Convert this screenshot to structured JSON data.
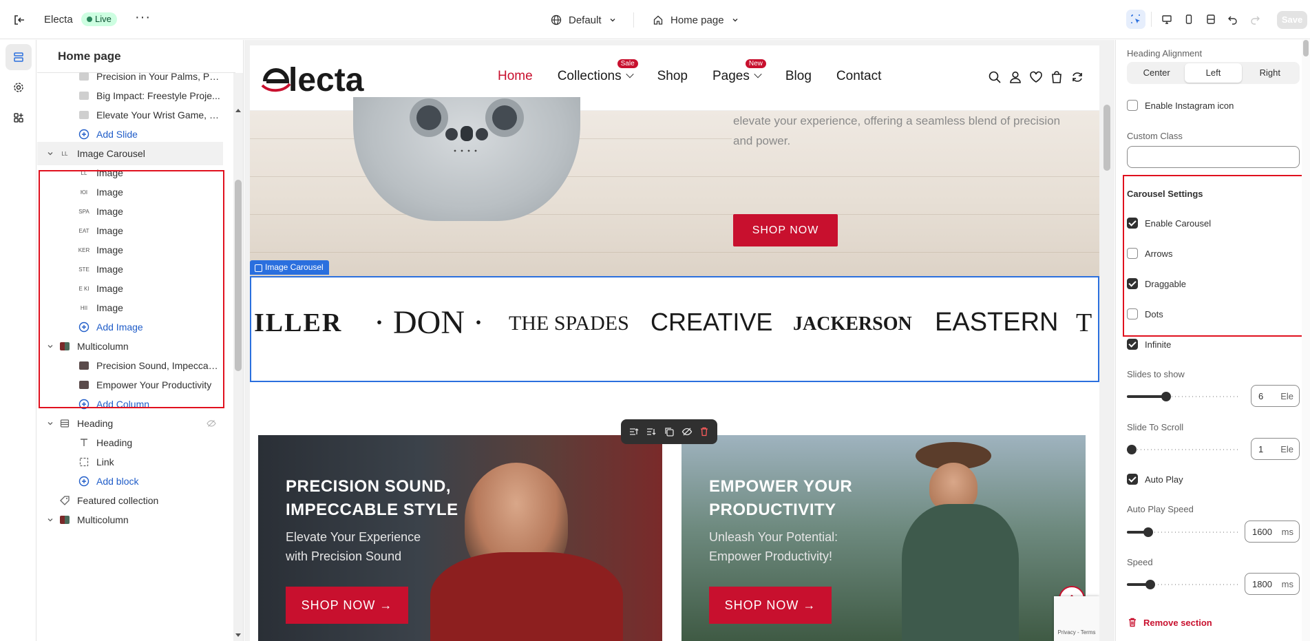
{
  "topbar": {
    "app_name": "Electa",
    "status": "Live",
    "theme": "Default",
    "page": "Home page",
    "save_label": "Save"
  },
  "tree": {
    "title": "Home page",
    "rows": [
      {
        "label": "Precision in Your Palms, Po...",
        "level": 2,
        "icon": "slide-thumb"
      },
      {
        "label": "Big Impact: Freestyle Proje...",
        "level": 2,
        "icon": "slide-thumb"
      },
      {
        "label": "Elevate Your Wrist Game, El...",
        "level": 2,
        "icon": "slide-thumb"
      },
      {
        "label": "Add Slide",
        "level": 2,
        "icon": "plus-circle-icon",
        "add": true
      },
      {
        "label": "Image Carousel",
        "level": 1,
        "icon": "carousel-thumb",
        "expanded": true,
        "selected": true
      },
      {
        "label": "Image",
        "level": 2,
        "icon": "brand-thumb",
        "thumb": "LL"
      },
      {
        "label": "Image",
        "level": 2,
        "icon": "brand-thumb",
        "thumb": "ЮI"
      },
      {
        "label": "Image",
        "level": 2,
        "icon": "brand-thumb",
        "thumb": "SPA"
      },
      {
        "label": "Image",
        "level": 2,
        "icon": "brand-thumb",
        "thumb": "EAT"
      },
      {
        "label": "Image",
        "level": 2,
        "icon": "brand-thumb",
        "thumb": "KER"
      },
      {
        "label": "Image",
        "level": 2,
        "icon": "brand-thumb",
        "thumb": "STE"
      },
      {
        "label": "Image",
        "level": 2,
        "icon": "brand-thumb",
        "thumb": "E KI"
      },
      {
        "label": "Image",
        "level": 2,
        "icon": "brand-thumb",
        "thumb": "HII"
      },
      {
        "label": "Add Image",
        "level": 2,
        "icon": "plus-circle-icon",
        "add": true
      },
      {
        "label": "Multicolumn",
        "level": 1,
        "icon": "multicolumn-thumb",
        "expanded": true
      },
      {
        "label": "Precision Sound, Impeccab...",
        "level": 2,
        "icon": "column-thumb"
      },
      {
        "label": "Empower Your Productivity",
        "level": 2,
        "icon": "column-thumb"
      },
      {
        "label": "Add Column",
        "level": 2,
        "icon": "plus-circle-icon",
        "add": true
      },
      {
        "label": "Heading",
        "level": 1,
        "icon": "heading-section-icon",
        "expanded": true,
        "hidden": true
      },
      {
        "label": "Heading",
        "level": 2,
        "icon": "text-icon"
      },
      {
        "label": "Link",
        "level": 2,
        "icon": "link-icon"
      },
      {
        "label": "Add block",
        "level": 2,
        "icon": "plus-circle-icon",
        "add": true
      },
      {
        "label": "Featured collection",
        "level": 1,
        "icon": "tag-icon"
      },
      {
        "label": "Multicolumn",
        "level": 1,
        "icon": "multicolumn-thumb",
        "expanded": true
      }
    ]
  },
  "store": {
    "logo": "electa",
    "nav": [
      {
        "label": "Home",
        "active": true
      },
      {
        "label": "Collections",
        "badge": "Sale",
        "dropdown": true
      },
      {
        "label": "Shop"
      },
      {
        "label": "Pages",
        "badge": "New",
        "dropdown": true
      },
      {
        "label": "Blog"
      },
      {
        "label": "Contact"
      }
    ],
    "hero": {
      "text": "elevate your experience, offering a seamless blend of precision and power.",
      "button": "SHOP NOW"
    },
    "section_tag": "Image Carousel",
    "brands": [
      "ILLER",
      "· DON ·",
      "THE SPADES",
      "CREATIVE",
      "JACKERSON",
      "EASTERN",
      "T"
    ],
    "banners": [
      {
        "title_line1": "PRECISION SOUND,",
        "title_line2": "IMPECCABLE STYLE",
        "sub_line1": "Elevate Your Experience",
        "sub_line2": "with Precision Sound",
        "button": "SHOP NOW →"
      },
      {
        "title_line1": "EMPOWER YOUR",
        "title_line2": "PRODUCTIVITY",
        "sub_line1": "Unleash Your Potential:",
        "sub_line2": "Empower Productivity!",
        "button": "SHOP NOW →"
      }
    ],
    "recaptcha": "Privacy - Terms"
  },
  "settings": {
    "heading_alignment_label": "Heading Alignment",
    "alignment_options": [
      "Center",
      "Left",
      "Right"
    ],
    "alignment_selected": "Left",
    "instagram_label": "Enable Instagram icon",
    "instagram_checked": false,
    "custom_class_label": "Custom Class",
    "custom_class_value": "",
    "carousel_title": "Carousel Settings",
    "carousel_options": [
      {
        "label": "Enable Carousel",
        "checked": true
      },
      {
        "label": "Arrows",
        "checked": false
      },
      {
        "label": "Draggable",
        "checked": true
      },
      {
        "label": "Dots",
        "checked": false
      },
      {
        "label": "Infinite",
        "checked": true
      }
    ],
    "slides_to_show_label": "Slides to show",
    "slides_to_show": "6",
    "slides_to_show_unit": "Ele",
    "slides_to_show_fraction": 0.33,
    "slide_to_scroll_label": "Slide To Scroll",
    "slide_to_scroll": "1",
    "slide_to_scroll_unit": "Ele",
    "slide_to_scroll_fraction": 0.0,
    "auto_play_label": "Auto Play",
    "auto_play_checked": true,
    "auto_play_speed_label": "Auto Play Speed",
    "auto_play_speed": "1600",
    "auto_play_speed_unit": "ms",
    "auto_play_speed_fraction": 0.16,
    "speed_label": "Speed",
    "speed": "1800",
    "speed_unit": "ms",
    "speed_fraction": 0.18,
    "remove_label": "Remove section"
  },
  "colors": {
    "brand_red": "#c8102e",
    "selection_blue": "#2a6fde",
    "highlight_red": "#e0101e",
    "link_blue": "#1f5cc8"
  }
}
